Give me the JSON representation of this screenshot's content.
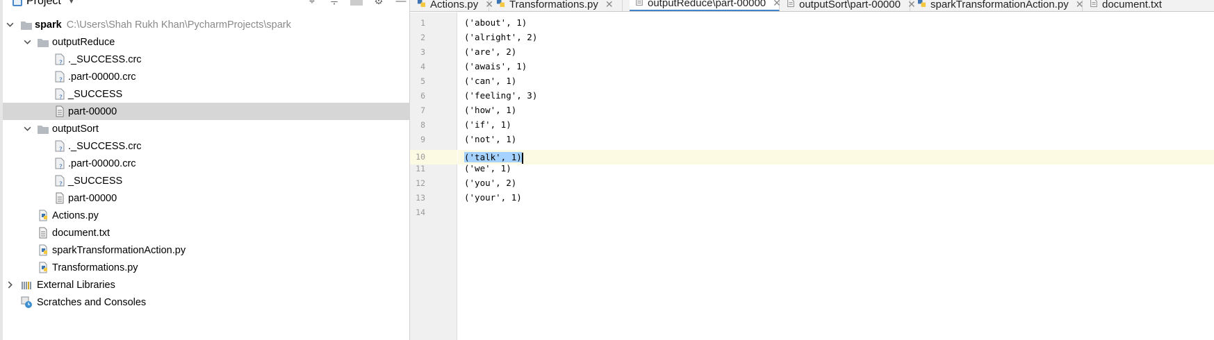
{
  "panel": {
    "title": "Project"
  },
  "tree": {
    "root": {
      "label": "spark",
      "path": "C:\\Users\\Shah Rukh Khan\\PycharmProjects\\spark"
    },
    "output_reduce": {
      "label": "outputReduce",
      "children": [
        "._SUCCESS.crc",
        ".part-00000.crc",
        "_SUCCESS",
        "part-00000"
      ]
    },
    "output_sort": {
      "label": "outputSort",
      "children": [
        "._SUCCESS.crc",
        ".part-00000.crc",
        "_SUCCESS",
        "part-00000"
      ]
    },
    "files": [
      "Actions.py",
      "document.txt",
      "sparkTransformationAction.py",
      "Transformations.py"
    ],
    "external_libraries": "External Libraries",
    "scratches": "Scratches and Consoles"
  },
  "tabs": [
    {
      "label": "Actions.py",
      "icon": "python-file-icon"
    },
    {
      "label": "Transformations.py",
      "icon": "python-file-icon"
    },
    {
      "label": "outputReduce\\part-00000",
      "icon": "text-file-icon",
      "active": true
    },
    {
      "label": "outputSort\\part-00000",
      "icon": "text-file-icon"
    },
    {
      "label": "sparkTransformationAction.py",
      "icon": "python-file-icon"
    },
    {
      "label": "document.txt",
      "icon": "text-file-icon"
    }
  ],
  "editor": {
    "current_line": 10,
    "line_numbers": [
      "1",
      "2",
      "3",
      "4",
      "5",
      "6",
      "7",
      "8",
      "9",
      "10",
      "11",
      "12",
      "13",
      "14"
    ],
    "lines": [
      "('about', 1)",
      "('alright', 2)",
      "('are', 2)",
      "('awais', 1)",
      "('can', 1)",
      "('feeling', 3)",
      "('how', 1)",
      "('if', 1)",
      "('not', 1)",
      "('talk', 1)",
      "('we', 1)",
      "('you', 2)",
      "('your', 1)",
      ""
    ]
  },
  "colors": {
    "folder": "#b4bac0",
    "python_blue": "#3d74b4",
    "python_yellow": "#f5c842",
    "accent": "#4083c9",
    "selection": "#a6d2ff",
    "current_line": "#fcfae3"
  }
}
